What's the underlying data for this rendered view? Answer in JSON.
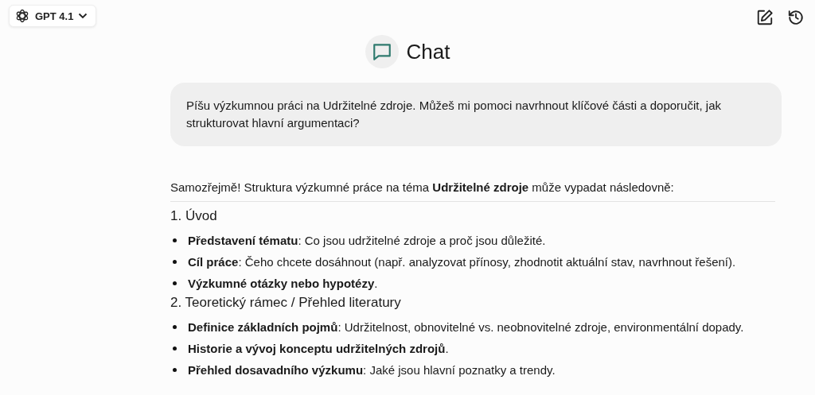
{
  "model_selector": {
    "label": "GPT 4.1"
  },
  "title": "Chat",
  "user_message": "Píšu výzkumnou práci na Udržitelné zdroje. Můžeš mi pomoci navrhnout klíčové části a doporučit, jak strukturovat hlavní argumentaci?",
  "reply": {
    "intro": "Samozřejmě! Struktura výzkumné práce na téma **Udržitelné zdroje** může vypadat následovně:",
    "sections": [
      {
        "heading": "1. Úvod",
        "items": [
          "**Představení tématu**: Co jsou udržitelné zdroje a proč jsou důležité.",
          "**Cíl práce**: Čeho chcete dosáhnout (např. analyzovat přínosy, zhodnotit aktuální stav, navrhnout řešení).",
          "**Výzkumné otázky nebo hypotézy**."
        ]
      },
      {
        "heading": "2. Teoretický rámec / Přehled literatury",
        "items": [
          "**Definice základních pojmů**: Udržitelnost, obnovitelné vs. neobnovitelné zdroje, environmentální dopady.",
          "**Historie a vývoj konceptu udržitelných zdrojů**.",
          "**Přehled dosavadního výzkumu**: Jaké jsou hlavní poznatky a trendy."
        ]
      }
    ]
  }
}
